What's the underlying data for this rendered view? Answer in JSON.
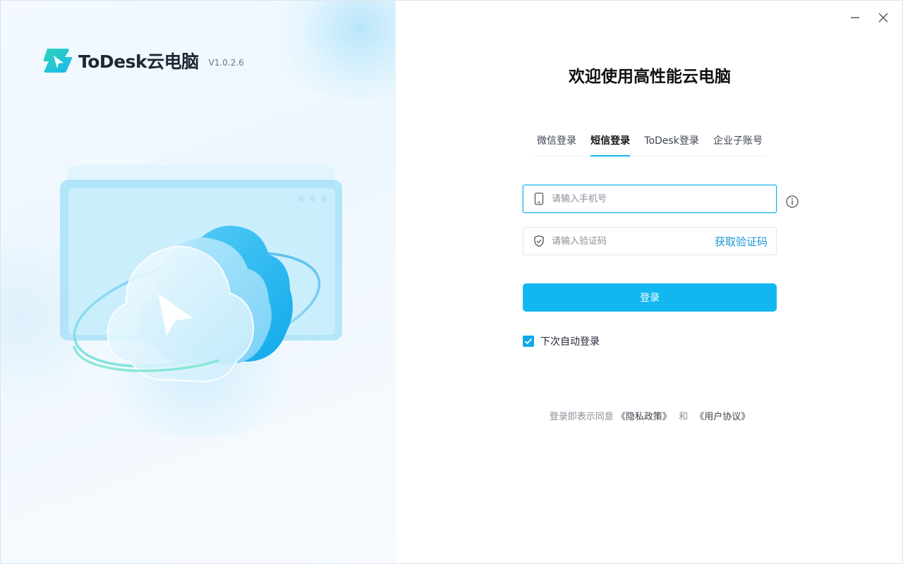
{
  "window": {
    "minimize_label": "Minimize",
    "close_label": "Close"
  },
  "brand": {
    "name": "ToDesk云电脑",
    "version": "V1.0.2.6",
    "accent": "#12b7f0"
  },
  "login": {
    "title": "欢迎使用高性能云电脑",
    "tabs": [
      {
        "label": "微信登录",
        "active": false
      },
      {
        "label": "短信登录",
        "active": true
      },
      {
        "label": "ToDesk登录",
        "active": false
      },
      {
        "label": "企业子账号",
        "active": false
      }
    ],
    "phone": {
      "placeholder": "请输入手机号",
      "value": "",
      "icon": "phone-icon"
    },
    "code": {
      "placeholder": "请输入验证码",
      "value": "",
      "icon": "shield-icon",
      "get_code_label": "获取验证码"
    },
    "info_icon": "info-icon",
    "submit_label": "登录",
    "auto_login": {
      "label": "下次自动登录",
      "checked": true
    },
    "agreement": {
      "prefix": "登录即表示同意",
      "privacy": "《隐私政策》",
      "and": "和",
      "terms": "《用户协议》"
    }
  }
}
